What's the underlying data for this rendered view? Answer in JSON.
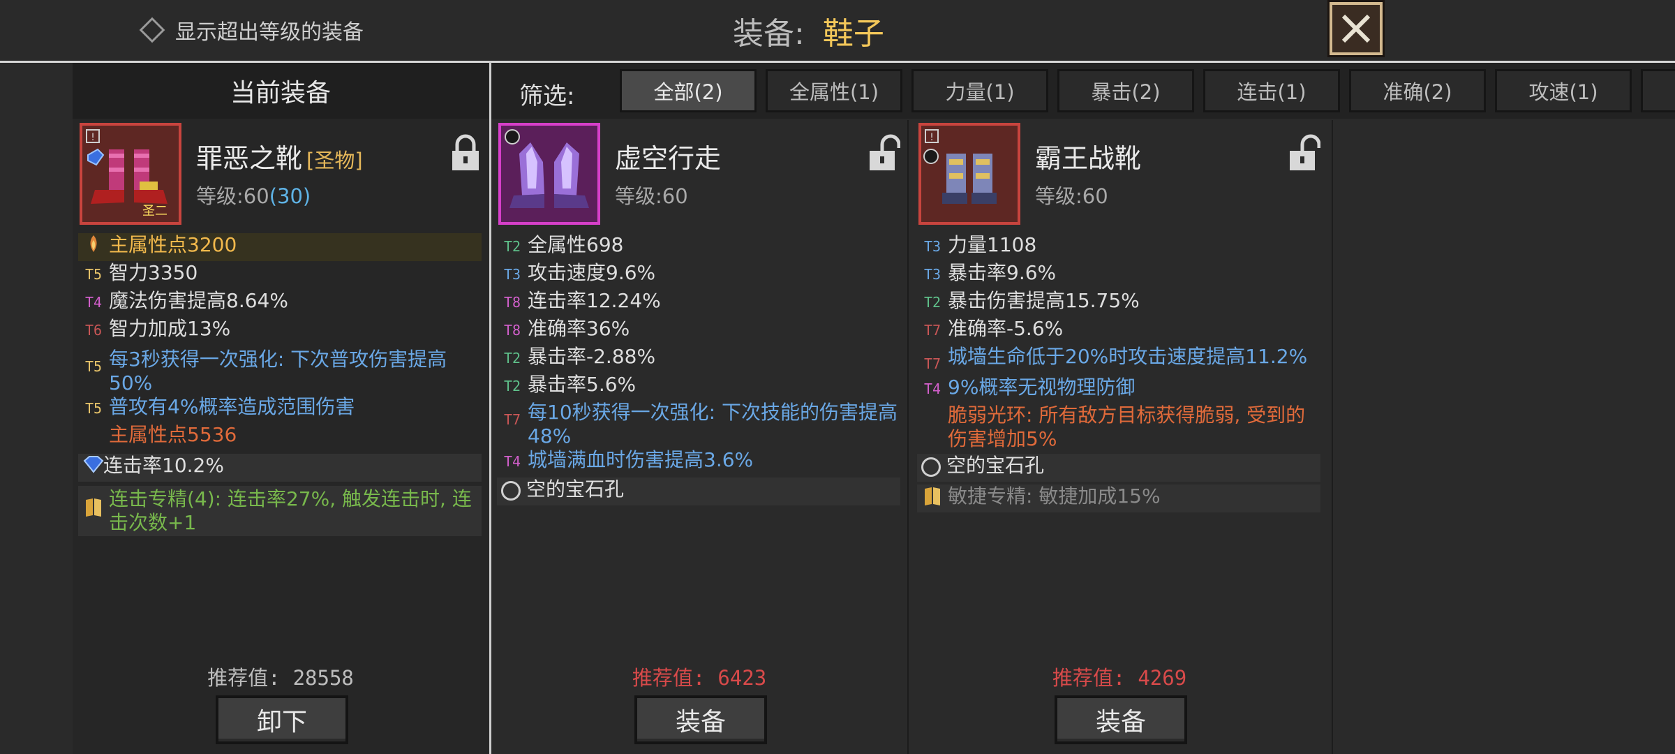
{
  "header": {
    "show_over_level": "显示超出等级的装备",
    "title_label": "装备:",
    "title_slot": "鞋子"
  },
  "current_header": "当前装备",
  "filter": {
    "label": "筛选:",
    "tabs": [
      "全部(2)",
      "全属性(1)",
      "力量(1)",
      "暴击(2)",
      "连击(1)",
      "准确(2)",
      "攻速(1)"
    ],
    "active": 0
  },
  "items": [
    {
      "name": "罪恶之靴",
      "tag": "[圣物]",
      "level_label": "等级:",
      "level": "60",
      "level_req": "(30)",
      "stats": [
        {
          "tier": "",
          "text": "主属性点3200",
          "style": "gold",
          "highlight": true
        },
        {
          "tier": "T5",
          "text": "智力3350"
        },
        {
          "tier": "T4",
          "text": "魔法伤害提高8.64%"
        },
        {
          "tier": "T6",
          "text": "智力加成13%"
        },
        {
          "tier": "T5",
          "text": "每3秒获得一次强化: 下次普攻伤害提高50%",
          "style": "blue"
        },
        {
          "tier": "T5",
          "text": "普攻有4%概率造成范围伤害",
          "style": "blue"
        },
        {
          "tier": "",
          "text": "主属性点5536",
          "style": "orange"
        },
        {
          "tier": "",
          "text": "连击率10.2%",
          "gem": true
        },
        {
          "tier": "",
          "text": "连击专精(4): 连击率27%, 触发连击时, 连击次数+1",
          "style": "green",
          "book": true
        }
      ],
      "recommend_label": "推荐值:",
      "recommend_value": "28558",
      "recommend_color": "#bdbdbd",
      "button": "卸下"
    },
    {
      "name": "虚空行走",
      "tag": "",
      "level_label": "等级:",
      "level": "60",
      "level_req": "",
      "stats": [
        {
          "tier": "T2",
          "text": "全属性698"
        },
        {
          "tier": "T3",
          "text": "攻击速度9.6%"
        },
        {
          "tier": "T8",
          "text": "连击率12.24%"
        },
        {
          "tier": "T8",
          "text": "准确率36%"
        },
        {
          "tier": "T2",
          "text": "暴击率-2.88%"
        },
        {
          "tier": "T2",
          "text": "暴击率5.6%"
        },
        {
          "tier": "T7",
          "text": "每10秒获得一次强化: 下次技能的伤害提高48%",
          "style": "blue"
        },
        {
          "tier": "T4",
          "text": "城墙满血时伤害提高3.6%",
          "style": "blue"
        },
        {
          "tier": "",
          "text": "空的宝石孔",
          "empty": true
        }
      ],
      "recommend_label": "推荐值:",
      "recommend_value": "6423",
      "recommend_color": "#d84a4a",
      "button": "装备"
    },
    {
      "name": "霸王战靴",
      "tag": "",
      "level_label": "等级:",
      "level": "60",
      "level_req": "",
      "stats": [
        {
          "tier": "T3",
          "text": "力量1108"
        },
        {
          "tier": "T3",
          "text": "暴击率9.6%"
        },
        {
          "tier": "T2",
          "text": "暴击伤害提高15.75%"
        },
        {
          "tier": "T7",
          "text": "准确率-5.6%"
        },
        {
          "tier": "T7",
          "text": "城墙生命低于20%时攻击速度提高11.2%",
          "style": "blue"
        },
        {
          "tier": "T4",
          "text": "9%概率无视物理防御",
          "style": "blue"
        },
        {
          "tier": "",
          "text": "脆弱光环: 所有敌方目标获得脆弱, 受到的伤害增加5%",
          "style": "orange"
        },
        {
          "tier": "",
          "text": "空的宝石孔",
          "empty": true
        },
        {
          "tier": "",
          "text": "敏捷专精: 敏捷加成15%",
          "book": true,
          "dim": true
        }
      ],
      "recommend_label": "推荐值:",
      "recommend_value": "4269",
      "recommend_color": "#d84a4a",
      "button": "装备"
    }
  ],
  "colors": {
    "accent_title": "#f4c85a",
    "tier_colors": {
      "T2": "#5fc08a",
      "T3": "#6aa8e6",
      "T4": "#d25fcb",
      "T5": "#e8c46a",
      "T6": "#c95656",
      "T7": "#c95656",
      "T8": "#d25fcb"
    }
  },
  "icons": [
    "diamond-checkbox-icon",
    "close-x-icon",
    "lock-icon",
    "unlock-icon",
    "boots-icon",
    "blue-gem-icon",
    "skill-book-icon",
    "empty-socket-icon"
  ]
}
